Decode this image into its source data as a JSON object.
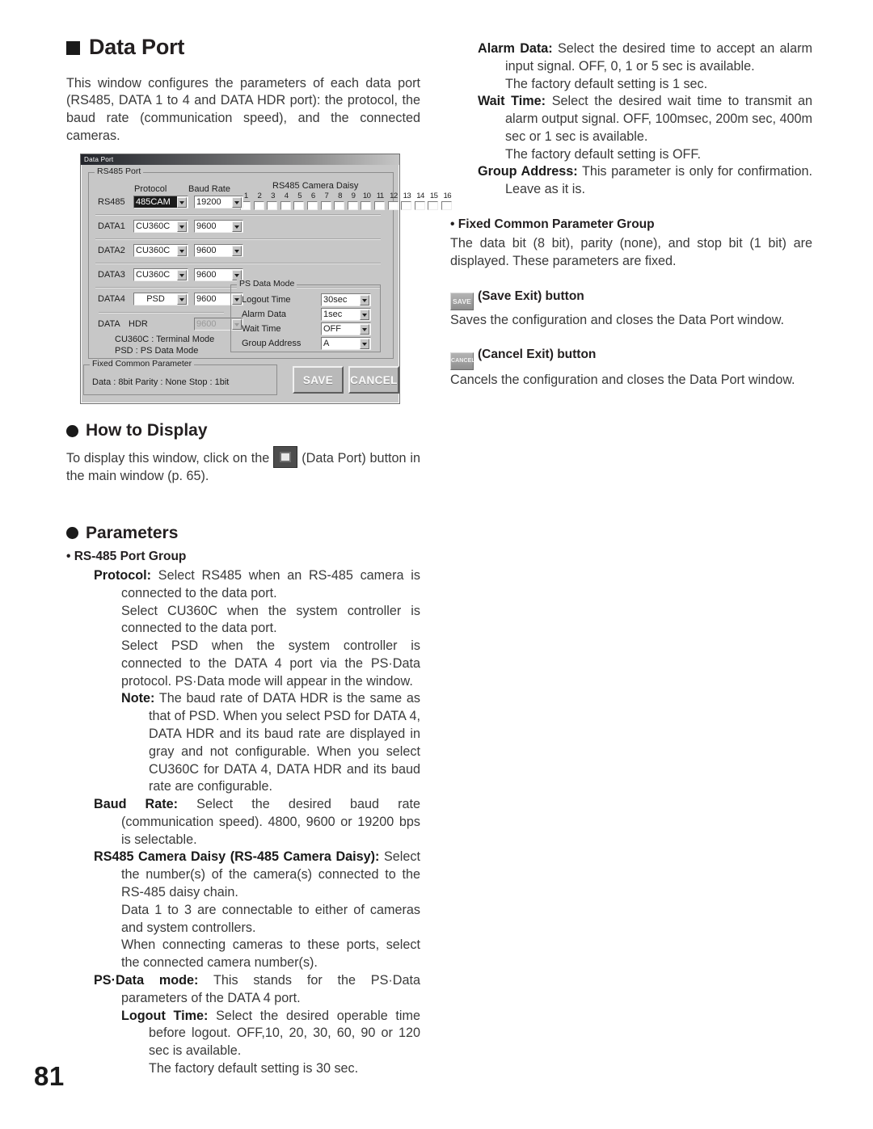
{
  "page": {
    "number": "81"
  },
  "left": {
    "title": "Data Port",
    "intro": "This window configures the parameters of each data port (RS485, DATA 1 to 4 and DATA HDR port): the protocol, the baud rate (communication speed), and the connected cameras.",
    "how_to_display": {
      "heading": "How to Display",
      "text_before": "To display this window, click on the",
      "text_after": "(Data Port) button in the main window (p. 65).",
      "icon_name": "data-port-icon"
    },
    "parameters": {
      "heading": "Parameters",
      "group_heading": "• RS-485 Port Group",
      "entries": [
        {
          "term": "Protocol:",
          "text": "Select RS485 when an RS-485 camera is connected to the data port."
        },
        {
          "term": "",
          "text": "Select CU360C when the system controller is connected to the data port."
        },
        {
          "term": "",
          "text": "Select PSD when the system controller is connected to the DATA 4 port via the PS·Data protocol. PS·Data mode will appear in the window."
        },
        {
          "term": "Note:",
          "text": "The baud rate of DATA HDR is the same as that of PSD. When you select PSD for DATA 4, DATA HDR and its baud rate are displayed in gray and not configurable. When you select CU360C for DATA 4, DATA HDR and its baud rate are configurable."
        },
        {
          "term": "Baud Rate:",
          "text": "Select the desired baud rate (communication speed). 4800, 9600 or 19200 bps is selectable."
        },
        {
          "term": "RS485 Camera Daisy (RS-485 Camera Daisy):",
          "text": "Select the number(s) of the camera(s) connected to the RS-485 daisy chain."
        },
        {
          "term": "",
          "text": "Data 1 to 3 are connectable to either of cameras and system controllers."
        },
        {
          "term": "",
          "text": "When connecting cameras to these ports, select the connected camera number(s)."
        },
        {
          "term": "PS·Data mode:",
          "text": "This stands for the PS·Data parameters of the DATA 4 port."
        },
        {
          "term": "Logout Time:",
          "text": "Select the desired operable time before logout. OFF,10, 20, 30, 60, 90 or 120 sec is available."
        },
        {
          "term": "",
          "text": "The factory default setting is 30 sec."
        }
      ]
    }
  },
  "right": {
    "entries": [
      {
        "term": "Alarm Data:",
        "text": "Select the desired time to accept an alarm input signal. OFF, 0, 1 or 5 sec is available."
      },
      {
        "term": "",
        "text": "The factory default setting is 1 sec."
      },
      {
        "term": "Wait Time:",
        "text": "Select the desired wait time to transmit an alarm output signal. OFF, 100msec, 200m sec, 400m sec or 1 sec is available."
      },
      {
        "term": "",
        "text": "The factory default setting is OFF."
      },
      {
        "term": "Group Address:",
        "text": "This parameter is only for confirmation. Leave as it is."
      }
    ],
    "fixed_group": {
      "heading": "• Fixed Common Parameter Group",
      "text": "The data bit (8 bit), parity (none), and stop bit (1 bit) are displayed. These parameters are fixed."
    },
    "save_button": {
      "chip": "SAVE",
      "heading": "(Save Exit) button",
      "text": "Saves the configuration and closes the Data Port window."
    },
    "cancel_button": {
      "chip": "CANCEL",
      "heading": "(Cancel Exit) button",
      "text": "Cancels the configuration and closes the Data Port window."
    }
  },
  "dialog": {
    "title": "Data Port",
    "rs485_group_label": "RS485 Port",
    "col_protocol": "Protocol",
    "col_baud": "Baud Rate",
    "daisy_header": "RS485 Camera Daisy",
    "daisy_numbers": [
      "1",
      "2",
      "3",
      "4",
      "5",
      "6",
      "7",
      "8",
      "9",
      "10",
      "11",
      "12",
      "13",
      "14",
      "15",
      "16"
    ],
    "rows": [
      {
        "label": "RS485",
        "protocol": "485CAM",
        "baud": "19200",
        "protocol_selected": true,
        "disabled": false
      },
      {
        "label": "DATA1",
        "protocol": "CU360C",
        "baud": "9600",
        "protocol_selected": false,
        "disabled": false
      },
      {
        "label": "DATA2",
        "protocol": "CU360C",
        "baud": "9600",
        "protocol_selected": false,
        "disabled": false
      },
      {
        "label": "DATA3",
        "protocol": "CU360C",
        "baud": "9600",
        "protocol_selected": false,
        "disabled": false
      },
      {
        "label": "DATA4",
        "protocol": "PSD",
        "baud": "9600",
        "protocol_selected": false,
        "disabled": false
      }
    ],
    "hdr_row": {
      "label_a": "DATA",
      "label_b": "HDR",
      "baud": "9600"
    },
    "legend": [
      "CU360C : Terminal Mode",
      "PSD       : PS Data Mode"
    ],
    "ps_data_mode": {
      "label": "PS Data Mode",
      "items": [
        {
          "label": "Logout Time",
          "value": "30sec"
        },
        {
          "label": "Alarm Data",
          "value": "1sec"
        },
        {
          "label": "Wait Time",
          "value": "OFF"
        },
        {
          "label": "Group Address",
          "value": "A"
        }
      ]
    },
    "fixed_common": {
      "label": "Fixed Common Parameter",
      "text": "Data : 8bit    Parity : None    Stop : 1bit"
    },
    "buttons": {
      "save": "SAVE",
      "cancel": "CANCEL"
    }
  }
}
